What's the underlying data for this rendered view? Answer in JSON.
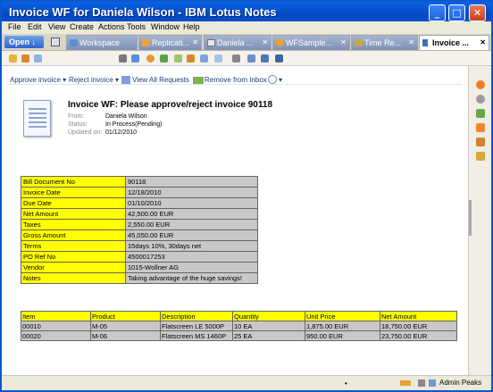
{
  "window": {
    "title": "Invoice WF for Daniela Wilson - IBM Lotus Notes"
  },
  "menu": [
    "File",
    "Edit",
    "View",
    "Create",
    "Actions",
    "Tools",
    "Window",
    "Help"
  ],
  "open_button": "Open ↓",
  "tabs": [
    {
      "label": "Workspace",
      "icon": "workspace-icon"
    },
    {
      "label": "Replicati...",
      "icon": "replication-icon"
    },
    {
      "label": "Daniela ...",
      "icon": "mail-icon"
    },
    {
      "label": "WFSample...",
      "icon": "db-icon"
    },
    {
      "label": "Time Re...",
      "icon": "time-icon"
    },
    {
      "label": "Invoice ...",
      "icon": "pencil-icon",
      "active": true
    }
  ],
  "actions": {
    "approve": "Approve invoice ▾",
    "reject": "Reject invoice ▾",
    "view_all": "View All Requests",
    "remove": "Remove from Inbox",
    "more": "▾"
  },
  "document": {
    "heading": "Invoice WF: Please approve/reject invoice 90118",
    "from_label": "From:",
    "from": "Daniela Wilson",
    "status_label": "Status:",
    "status": "In Process(Pending)",
    "updated_label": "Updated on:",
    "updated": "01/12/2010"
  },
  "fields": [
    {
      "k": "Bill Document No",
      "v": "90118"
    },
    {
      "k": "Invoice Date",
      "v": "12/18/2010"
    },
    {
      "k": "Due Date",
      "v": "01/10/2010"
    },
    {
      "k": "Net Amount",
      "v": "42,500.00 EUR"
    },
    {
      "k": "Taxes",
      "v": "2,550.00 EUR"
    },
    {
      "k": "Gross Amount",
      "v": "45,050.00 EUR"
    },
    {
      "k": "Terms",
      "v": "15days 10%, 30days net"
    },
    {
      "k": "PO Ref No",
      "v": "4500017253"
    },
    {
      "k": "Vendor",
      "v": "1015-Wollner AG"
    },
    {
      "k": "Notes",
      "v": "Taking advantage of the huge savings!"
    }
  ],
  "items": {
    "headers": [
      "Item",
      "Product",
      "Description",
      "Quantity",
      "Unit Price",
      "Net Amount"
    ],
    "rows": [
      [
        "00010",
        "M-05",
        "Flatscreen LE 5000P",
        "10 EA",
        "1,875.00 EUR",
        "18,750.00 EUR"
      ],
      [
        "00020",
        "M-06",
        "Flatscreen MS 1460P",
        "25 EA",
        "950.00 EUR",
        "23,750.00 EUR"
      ]
    ]
  },
  "status": {
    "user": "Admin Peaks",
    "dot": "•"
  },
  "colors": {
    "title_bar": "#0348c0",
    "field_label": "#ffff00",
    "field_value": "#c8c8c8"
  }
}
